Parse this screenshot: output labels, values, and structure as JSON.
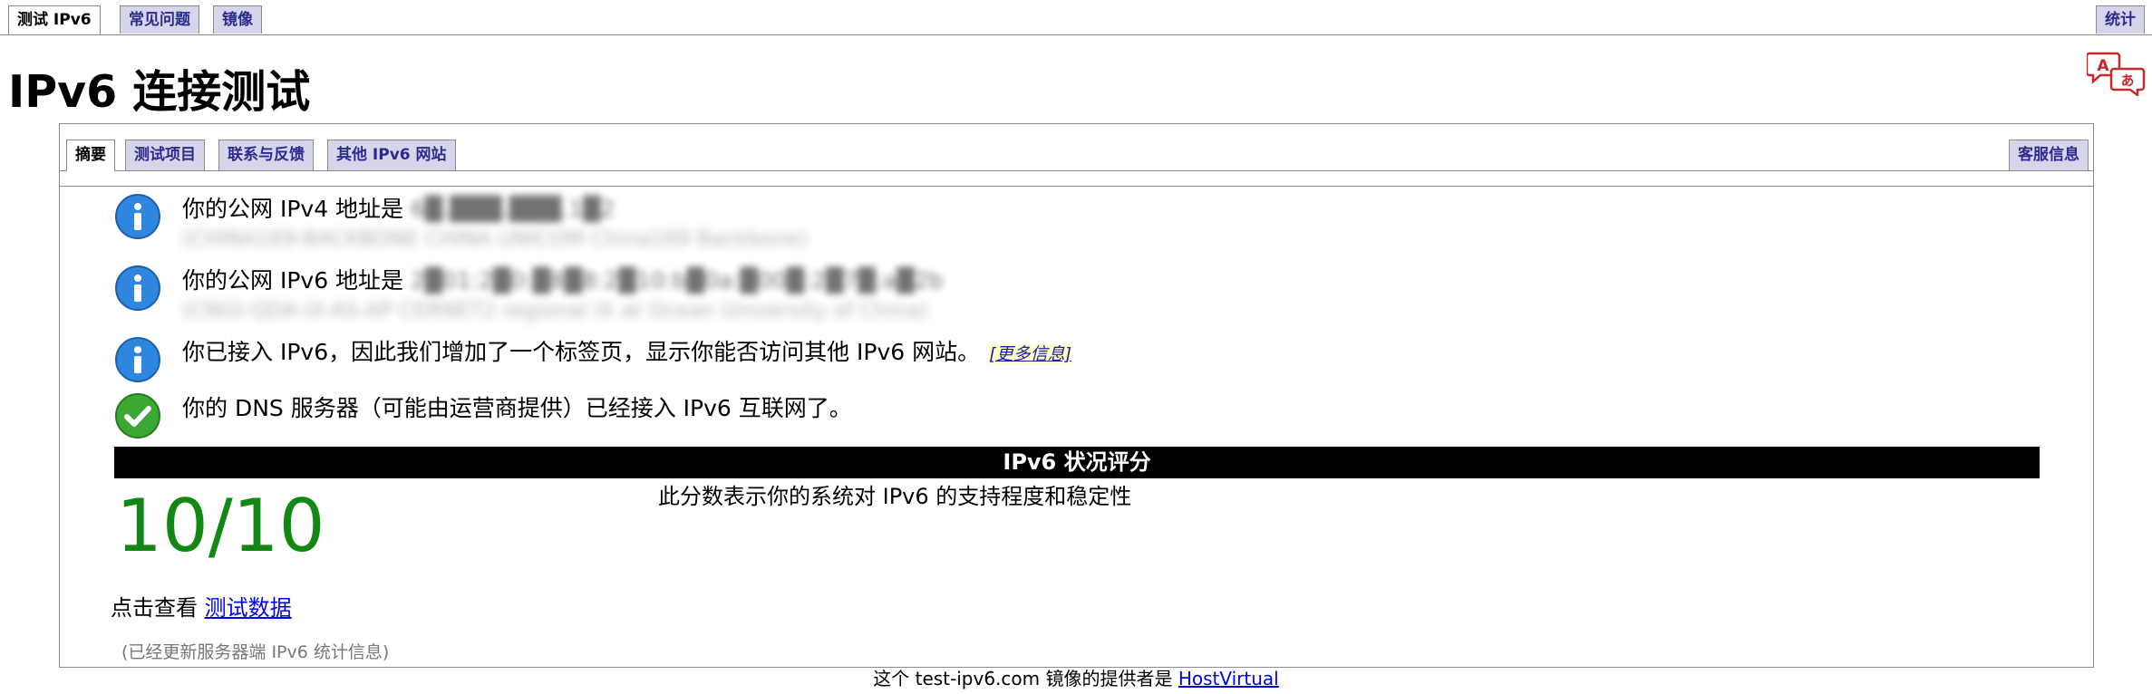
{
  "top_tabs": {
    "test": "测试 IPv6",
    "faq": "常见问题",
    "mirror": "镜像",
    "stats": "统计"
  },
  "page_title": "IPv6 连接测试",
  "sub_tabs": {
    "summary": "摘要",
    "tests": "测试项目",
    "contact": "联系与反馈",
    "other_sites": "其他 IPv6 网站",
    "support": "客服信息"
  },
  "results": {
    "ipv4_prefix": "你的公网 IPv4 地址是",
    "ipv4_value": "6█.███.███.1█2",
    "ipv4_isp": "(CHINA169-BACKBONE CHINA UNICOM China169 Backbone)",
    "ipv6_prefix": "你的公网 IPv6 地址是",
    "ipv6_value": "2█01:2█0:█8█8:2█10:b█0a:█00█:2█7█:a█2b",
    "ipv6_isp": "(CNGI-QDA-IX-AS-AP CERNET2 regional IX at Ocean University of China)",
    "tab_added": "你已接入 IPv6，因此我们增加了一个标签页，显示你能否访问其他 IPv6 网站。",
    "more_info": "[更多信息]",
    "dns": "你的 DNS 服务器（可能由运营商提供）已经接入 IPv6 互联网了。"
  },
  "score": {
    "header": "IPv6 状况评分",
    "value": "10/10",
    "description": "此分数表示你的系统对 IPv6 的支持程度和稳定性"
  },
  "view_data": {
    "prefix": "点击查看",
    "link": "测试数据"
  },
  "server_note": "(已经更新服务器端 IPv6 统计信息)",
  "footer": {
    "prefix": "这个 test-ipv6.com 镜像的提供者是",
    "link": "HostVirtual"
  },
  "colors": {
    "info_icon": "#2e86de",
    "ok_icon": "#3aa832",
    "score": "#118811",
    "tab_bg": "#d6d6ea",
    "tab_text": "#2b2b8f"
  },
  "icons": [
    "translate-icon",
    "info-icon",
    "checkmark-icon"
  ]
}
